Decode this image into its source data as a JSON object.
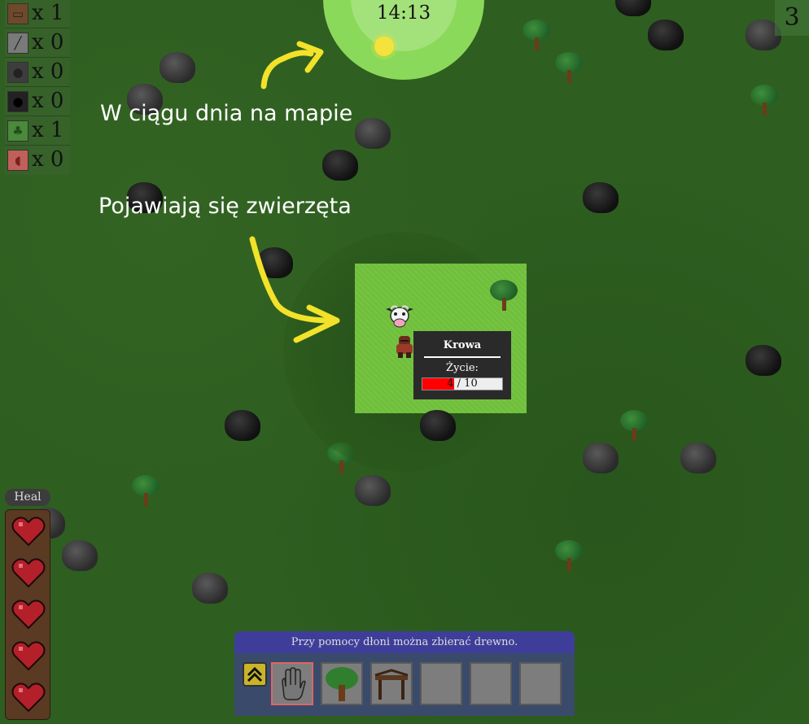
{
  "inventory": [
    {
      "icon": "wood-log-icon",
      "count": "x 1"
    },
    {
      "icon": "stick-icon",
      "count": "x 0"
    },
    {
      "icon": "stone-icon",
      "count": "x 0"
    },
    {
      "icon": "coal-icon",
      "count": "x 0"
    },
    {
      "icon": "sapling-icon",
      "count": "x 1"
    },
    {
      "icon": "meat-icon",
      "count": "x 0"
    }
  ],
  "clock": {
    "time": "14:13"
  },
  "day_counter": "3",
  "captions": {
    "first": "W ciągu dnia na mapie",
    "second": "Pojawiają się zwierzęta"
  },
  "tooltip": {
    "title": "Krowa",
    "life_label": "Życie:",
    "health": {
      "current": 4,
      "max": 10,
      "text": "4 / 10"
    }
  },
  "health_panel": {
    "heal_label": "Heal",
    "hearts": 5
  },
  "toolbar": {
    "hint": "Przy pomocy dłoni można zbierać drewno.",
    "slots": [
      {
        "item": "hand-icon",
        "selected": true
      },
      {
        "item": "tree-icon",
        "selected": false
      },
      {
        "item": "workbench-icon",
        "selected": false
      },
      {
        "item": "",
        "selected": false
      },
      {
        "item": "",
        "selected": false
      },
      {
        "item": "",
        "selected": false
      }
    ]
  },
  "colors": {
    "accent_yellow": "#f2e22a",
    "health_red": "#ff0000",
    "grass": "#6fbf3a"
  }
}
